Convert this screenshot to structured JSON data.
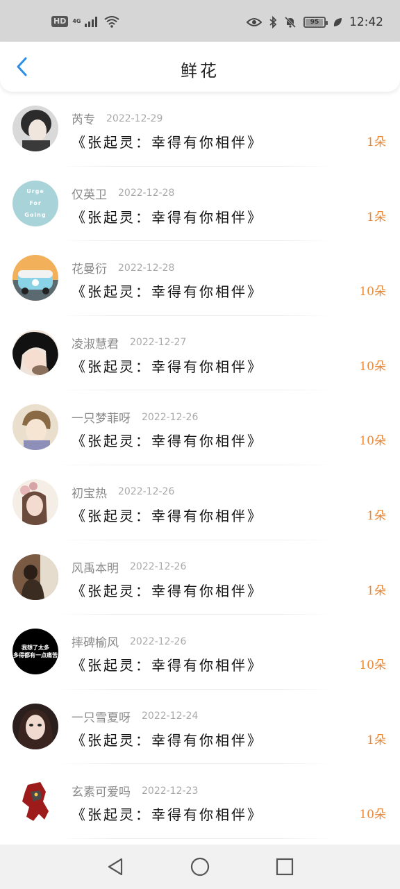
{
  "status_bar": {
    "hd": "HD",
    "network": "4G",
    "battery": "95",
    "battery_level": 0.95,
    "time": "12:42"
  },
  "header": {
    "title": "鲜花"
  },
  "rows": [
    {
      "name": "芮专",
      "date": "2022-12-29",
      "book": "《张起灵：幸得有你相伴》",
      "amount": "1朵",
      "avatar_icon": "boy-portrait"
    },
    {
      "name": "仅英卫",
      "date": "2022-12-28",
      "book": "《张起灵：幸得有你相伴》",
      "amount": "1朵",
      "avatar_text": [
        "Urge",
        "For",
        "Going"
      ],
      "avatar_color": "#a8d3d8"
    },
    {
      "name": "花曼衍",
      "date": "2022-12-28",
      "book": "《张起灵：幸得有你相伴》",
      "amount": "10朵",
      "avatar_icon": "vw-van"
    },
    {
      "name": "凌淑慧君",
      "date": "2022-12-27",
      "book": "《张起灵：幸得有你相伴》",
      "amount": "10朵",
      "avatar_icon": "anime-girl"
    },
    {
      "name": "一只梦菲呀",
      "date": "2022-12-26",
      "book": "《张起灵：幸得有你相伴》",
      "amount": "10朵",
      "avatar_icon": "anime-boy"
    },
    {
      "name": "初宝热",
      "date": "2022-12-26",
      "book": "《张起灵：幸得有你相伴》",
      "amount": "1朵",
      "avatar_icon": "flower-girl"
    },
    {
      "name": "风禹本明",
      "date": "2022-12-26",
      "book": "《张起灵：幸得有你相伴》",
      "amount": "1朵",
      "avatar_icon": "sitting-person"
    },
    {
      "name": "摔碑榆风",
      "date": "2022-12-26",
      "book": "《张起灵：幸得有你相伴》",
      "amount": "10朵",
      "avatar_text": [
        "我想了太多",
        "多得都有一点痛苦"
      ],
      "avatar_color": "#000000"
    },
    {
      "name": "一只雪夏呀",
      "date": "2022-12-24",
      "book": "《张起灵：幸得有你相伴》",
      "amount": "1朵",
      "avatar_icon": "girl-portrait"
    },
    {
      "name": "玄素可爱吗",
      "date": "2022-12-23",
      "book": "《张起灵：幸得有你相伴》",
      "amount": "10朵",
      "avatar_icon": "red-robot"
    }
  ],
  "colors": {
    "accent_blue": "#2a8ee8",
    "amount_orange": "#e8893a",
    "status_bar_bg": "#d6d6d6"
  }
}
